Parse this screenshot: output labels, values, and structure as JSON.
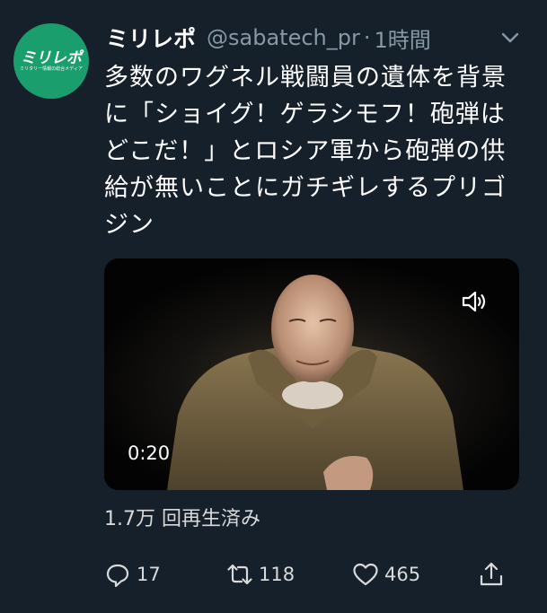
{
  "account": {
    "display_name": "ミリレポ",
    "handle": "@sabatech_pr",
    "separator": "·",
    "timestamp": "1時間",
    "avatar_logo": "ミリレポ",
    "avatar_tagline": "ミリタリー情報の総合メディア"
  },
  "tweet": {
    "text": "多数のワグネル戦闘員の遺体を背景に「ショイグ！ゲラシモフ！砲弾はどこだ！」とロシア軍から砲弾の供給が無いことにガチギレするプリゴジン"
  },
  "video": {
    "duration": "0:20",
    "sound_icon": "speaker-icon"
  },
  "stats": {
    "views": "1.7万 回再生済み"
  },
  "actions": {
    "replies": "17",
    "retweets": "118",
    "likes": "465"
  },
  "colors": {
    "background": "#15202b",
    "secondary_text": "#8899a6",
    "avatar_bg": "#1a9e6e"
  }
}
